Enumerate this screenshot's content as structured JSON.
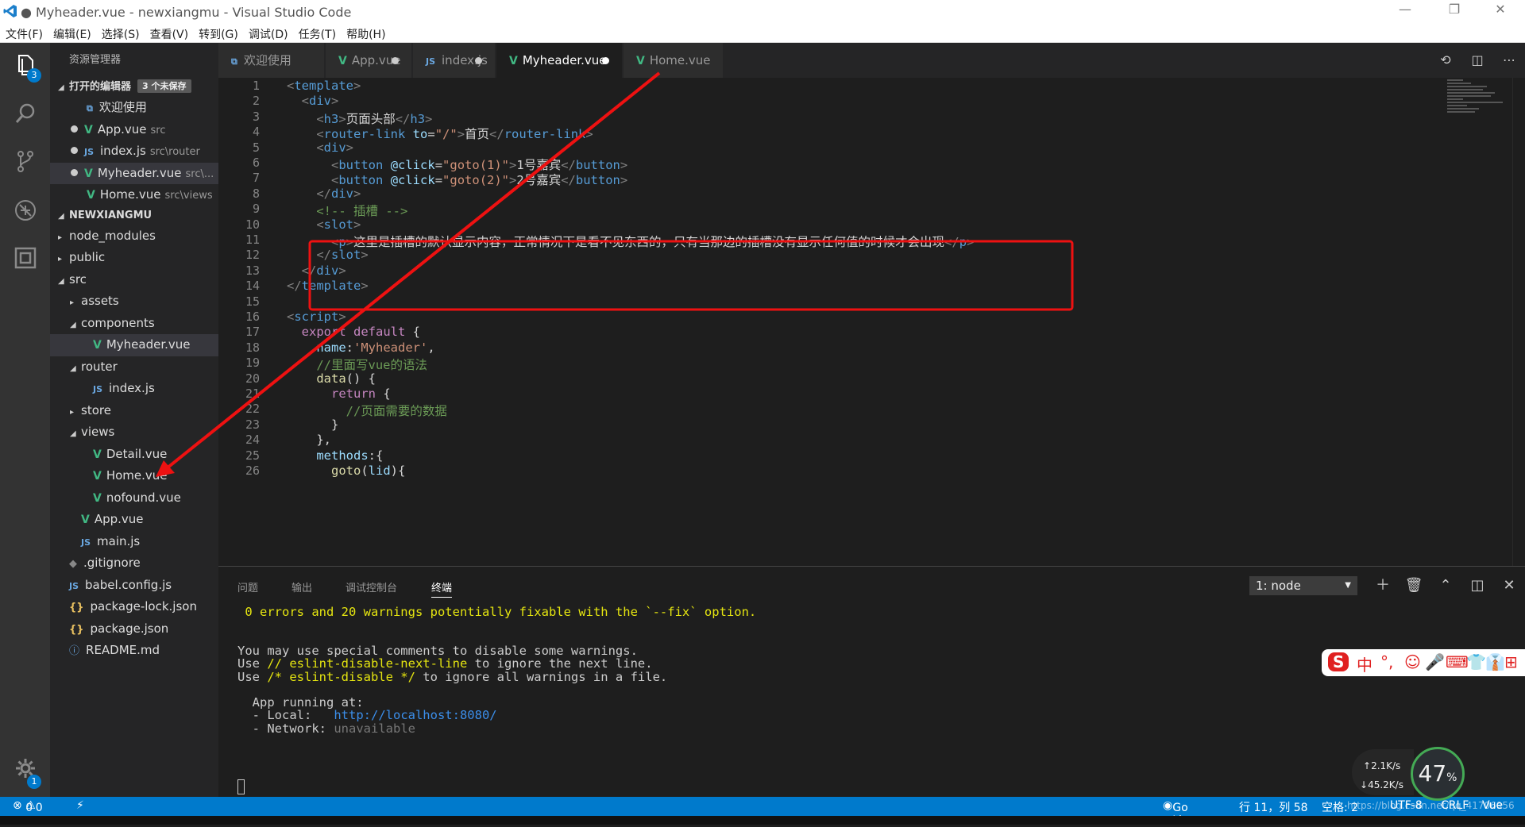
{
  "titlebar": {
    "title": "● Myheader.vue - newxiangmu - Visual Studio Code",
    "min": "—",
    "max": "❐",
    "close": "✕"
  },
  "menu": [
    "文件(F)",
    "编辑(E)",
    "选择(S)",
    "查看(V)",
    "转到(G)",
    "调试(D)",
    "任务(T)",
    "帮助(H)"
  ],
  "activity": {
    "explorer_badge": "3",
    "settings_badge": "1",
    "icons": [
      "files-icon",
      "search-icon",
      "source-control-icon",
      "debug-icon",
      "extensions-icon",
      "gear-icon"
    ]
  },
  "sidebar": {
    "header": "资源管理器",
    "open_editors": {
      "title": "打开的编辑器",
      "unsaved": "3 个未保存",
      "items": [
        {
          "icon": "vscode",
          "name": "欢迎使用",
          "hint": "",
          "dirty": false
        },
        {
          "icon": "vue",
          "name": "App.vue",
          "hint": "src",
          "dirty": true
        },
        {
          "icon": "js",
          "name": "index.js",
          "hint": "src\\router",
          "dirty": true
        },
        {
          "icon": "vue",
          "name": "Myheader.vue",
          "hint": "src\\...",
          "dirty": true
        },
        {
          "icon": "vue",
          "name": "Home.vue",
          "hint": "src\\views",
          "dirty": false
        }
      ]
    },
    "project": {
      "title": "NEWXIANGMU",
      "tree": [
        {
          "depth": 0,
          "twisty": "▸",
          "icon": "",
          "name": "node_modules"
        },
        {
          "depth": 0,
          "twisty": "▸",
          "icon": "",
          "name": "public"
        },
        {
          "depth": 0,
          "twisty": "◢",
          "icon": "",
          "name": "src"
        },
        {
          "depth": 1,
          "twisty": "▸",
          "icon": "",
          "name": "assets"
        },
        {
          "depth": 1,
          "twisty": "◢",
          "icon": "",
          "name": "components"
        },
        {
          "depth": 2,
          "twisty": "",
          "icon": "vue",
          "name": "Myheader.vue",
          "selected": true
        },
        {
          "depth": 1,
          "twisty": "◢",
          "icon": "",
          "name": "router"
        },
        {
          "depth": 2,
          "twisty": "",
          "icon": "js",
          "name": "index.js"
        },
        {
          "depth": 1,
          "twisty": "▸",
          "icon": "",
          "name": "store"
        },
        {
          "depth": 1,
          "twisty": "◢",
          "icon": "",
          "name": "views"
        },
        {
          "depth": 2,
          "twisty": "",
          "icon": "vue",
          "name": "Detail.vue"
        },
        {
          "depth": 2,
          "twisty": "",
          "icon": "vue",
          "name": "Home.vue"
        },
        {
          "depth": 2,
          "twisty": "",
          "icon": "vue",
          "name": "nofound.vue"
        },
        {
          "depth": 1,
          "twisty": "",
          "icon": "vue",
          "name": "App.vue"
        },
        {
          "depth": 1,
          "twisty": "",
          "icon": "js",
          "name": "main.js"
        },
        {
          "depth": 0,
          "twisty": "",
          "icon": "git",
          "name": ".gitignore"
        },
        {
          "depth": 0,
          "twisty": "",
          "icon": "js",
          "name": "babel.config.js"
        },
        {
          "depth": 0,
          "twisty": "",
          "icon": "json",
          "name": "package-lock.json"
        },
        {
          "depth": 0,
          "twisty": "",
          "icon": "json",
          "name": "package.json"
        },
        {
          "depth": 0,
          "twisty": "",
          "icon": "info",
          "name": "README.md"
        }
      ]
    }
  },
  "tabs": [
    {
      "icon": "vscode",
      "label": "欢迎使用",
      "dirty": false,
      "active": false
    },
    {
      "icon": "vue",
      "label": "App.vue",
      "dirty": true,
      "active": false
    },
    {
      "icon": "js",
      "label": "index.js",
      "dirty": true,
      "active": false
    },
    {
      "icon": "vue",
      "label": "Myheader.vue",
      "dirty": true,
      "active": true
    },
    {
      "icon": "vue",
      "label": "Home.vue",
      "dirty": false,
      "active": false
    }
  ],
  "icon_glyphs": {
    "vue": "V",
    "js": "JS",
    "json": "{}",
    "info": "ⓘ",
    "git": "◆",
    "vscode": "⧉"
  },
  "code": [
    [
      [
        "br",
        "<"
      ],
      [
        "tg",
        "template"
      ],
      [
        "br",
        ">"
      ]
    ],
    [
      [
        "t",
        "  "
      ],
      [
        "br",
        "<"
      ],
      [
        "tg",
        "div"
      ],
      [
        "br",
        ">"
      ]
    ],
    [
      [
        "t",
        "    "
      ],
      [
        "br",
        "<"
      ],
      [
        "tg",
        "h3"
      ],
      [
        "br",
        ">"
      ],
      [
        "t",
        "页面头部"
      ],
      [
        "br",
        "</"
      ],
      [
        "tg",
        "h3"
      ],
      [
        "br",
        ">"
      ]
    ],
    [
      [
        "t",
        "    "
      ],
      [
        "br",
        "<"
      ],
      [
        "tg",
        "router-link"
      ],
      [
        "t",
        " "
      ],
      [
        "at",
        "to"
      ],
      [
        "t",
        "="
      ],
      [
        "st",
        "\"/\""
      ],
      [
        "br",
        ">"
      ],
      [
        "t",
        "首页"
      ],
      [
        "br",
        "</"
      ],
      [
        "tg",
        "router-link"
      ],
      [
        "br",
        ">"
      ]
    ],
    [
      [
        "t",
        "    "
      ],
      [
        "br",
        "<"
      ],
      [
        "tg",
        "div"
      ],
      [
        "br",
        ">"
      ]
    ],
    [
      [
        "t",
        "      "
      ],
      [
        "br",
        "<"
      ],
      [
        "tg",
        "button"
      ],
      [
        "t",
        " "
      ],
      [
        "at",
        "@click"
      ],
      [
        "t",
        "="
      ],
      [
        "st",
        "\"goto(1)\""
      ],
      [
        "br",
        ">"
      ],
      [
        "t",
        "1号嘉宾"
      ],
      [
        "br",
        "</"
      ],
      [
        "tg",
        "button"
      ],
      [
        "br",
        ">"
      ]
    ],
    [
      [
        "t",
        "      "
      ],
      [
        "br",
        "<"
      ],
      [
        "tg",
        "button"
      ],
      [
        "t",
        " "
      ],
      [
        "at",
        "@click"
      ],
      [
        "t",
        "="
      ],
      [
        "st",
        "\"goto(2)\""
      ],
      [
        "br",
        ">"
      ],
      [
        "t",
        "2号嘉宾"
      ],
      [
        "br",
        "</"
      ],
      [
        "tg",
        "button"
      ],
      [
        "br",
        ">"
      ]
    ],
    [
      [
        "t",
        "    "
      ],
      [
        "br",
        "</"
      ],
      [
        "tg",
        "div"
      ],
      [
        "br",
        ">"
      ]
    ],
    [
      [
        "t",
        "    "
      ],
      [
        "cm",
        "<!-- 插槽 -->"
      ]
    ],
    [
      [
        "t",
        "    "
      ],
      [
        "br",
        "<"
      ],
      [
        "tg",
        "slot"
      ],
      [
        "br",
        ">"
      ]
    ],
    [
      [
        "t",
        "      "
      ],
      [
        "br",
        "<"
      ],
      [
        "tg",
        "p"
      ],
      [
        "br",
        ">"
      ],
      [
        "t",
        "这里是插槽的默认显示内容，正常情况下是看不见东西的，只有当那边的插槽没有显示任何值的时候才会出现"
      ],
      [
        "br",
        "</"
      ],
      [
        "tg",
        "p"
      ],
      [
        "br",
        ">"
      ]
    ],
    [
      [
        "t",
        "    "
      ],
      [
        "br",
        "</"
      ],
      [
        "tg",
        "slot"
      ],
      [
        "br",
        ">"
      ]
    ],
    [
      [
        "t",
        "  "
      ],
      [
        "br",
        "</"
      ],
      [
        "tg",
        "div"
      ],
      [
        "br",
        ">"
      ]
    ],
    [
      [
        "br",
        "</"
      ],
      [
        "tg",
        "template"
      ],
      [
        "br",
        ">"
      ]
    ],
    [],
    [
      [
        "br",
        "<"
      ],
      [
        "tg",
        "script"
      ],
      [
        "br",
        ">"
      ]
    ],
    [
      [
        "t",
        "  "
      ],
      [
        "kw",
        "export"
      ],
      [
        "t",
        " "
      ],
      [
        "kw",
        "default"
      ],
      [
        "t",
        " {"
      ]
    ],
    [
      [
        "t",
        "    "
      ],
      [
        "at",
        "name"
      ],
      [
        "t",
        ":"
      ],
      [
        "st",
        "'Myheader'"
      ],
      [
        "t",
        ","
      ]
    ],
    [
      [
        "t",
        "    "
      ],
      [
        "cm",
        "//里面写vue的语法"
      ]
    ],
    [
      [
        "t",
        "    "
      ],
      [
        "fn",
        "data"
      ],
      [
        "t",
        "() {"
      ]
    ],
    [
      [
        "t",
        "      "
      ],
      [
        "kw",
        "return"
      ],
      [
        "t",
        " {"
      ]
    ],
    [
      [
        "t",
        "        "
      ],
      [
        "cm",
        "//页面需要的数据"
      ]
    ],
    [
      [
        "t",
        "      }"
      ]
    ],
    [
      [
        "t",
        "    },"
      ]
    ],
    [
      [
        "t",
        "    "
      ],
      [
        "at",
        "methods"
      ],
      [
        "t",
        ":{"
      ]
    ],
    [
      [
        "t",
        "      "
      ],
      [
        "fn",
        "goto"
      ],
      [
        "t",
        "("
      ],
      [
        "at",
        "lid"
      ],
      [
        "t",
        "){"
      ]
    ]
  ],
  "panel": {
    "tabs": [
      "问题",
      "输出",
      "调试控制台",
      "终端"
    ],
    "active_tab": "终端",
    "terminal_select": "1: node",
    "actions": [
      "＋",
      "🗑",
      "⌃",
      "◫",
      "✕"
    ],
    "lines": [
      [
        [
          "t",
          " "
        ],
        [
          "y",
          "0 errors and 20 warnings potentially fixable with the `--fix` option."
        ]
      ],
      [],
      [],
      [
        [
          "t",
          "You may use special comments to disable some warnings."
        ]
      ],
      [
        [
          "t",
          "Use "
        ],
        [
          "y",
          "// eslint-disable-next-line"
        ],
        [
          "t",
          " to ignore the next line."
        ]
      ],
      [
        [
          "t",
          "Use "
        ],
        [
          "y",
          "/* eslint-disable */"
        ],
        [
          "t",
          " to ignore all warnings in a file."
        ]
      ],
      [],
      [
        [
          "t",
          "  App running at:"
        ]
      ],
      [
        [
          "t",
          "  - Local:   "
        ],
        [
          "ur",
          "http://localhost:8080/"
        ]
      ],
      [
        [
          "t",
          "  - Network: "
        ],
        [
          "gr",
          "unavailable"
        ]
      ]
    ]
  },
  "statusbar": {
    "errors": "0",
    "warnings": "0",
    "golive": "Go Live",
    "position": "行 11，列 58",
    "spaces": "空格: 2",
    "encoding": "UTF-8",
    "eol": "CRLF",
    "lang": "Vue",
    "watermark": "https://blog.csdn.net/qq_41706956"
  },
  "ime": [
    "S",
    "中",
    "°,",
    "☺",
    "🎤",
    "⌨",
    "👕",
    "👔",
    "⊞"
  ],
  "netmon": {
    "up": "2.1K/s",
    "down": "45.2K/s",
    "cpu": "47",
    "unit": "%"
  },
  "colors": {
    "accent": "#007acc",
    "vue_green": "#41b883",
    "annotation_red": "#ee1111"
  }
}
